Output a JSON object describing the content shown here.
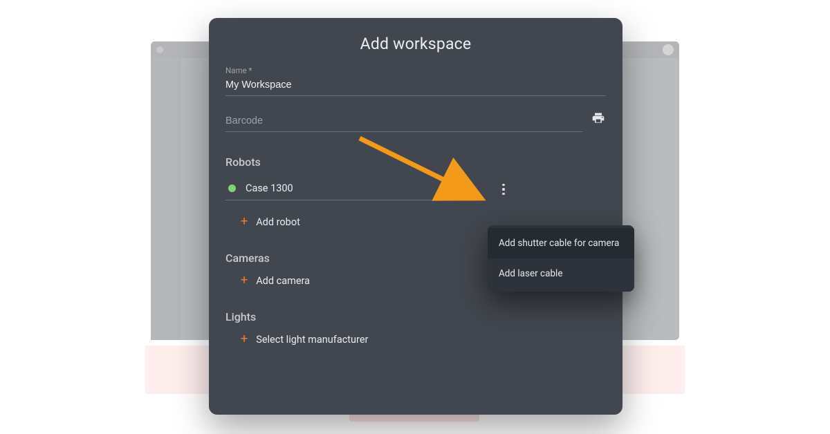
{
  "dialog": {
    "title": "Add workspace",
    "name": {
      "label": "Name *",
      "value": "My Workspace"
    },
    "barcode": {
      "placeholder": "Barcode",
      "value": ""
    },
    "sections": {
      "robots": {
        "heading": "Robots",
        "selected": {
          "name": "Case 1300",
          "status_color": "#7fd37a"
        },
        "add_label": "Add robot"
      },
      "cameras": {
        "heading": "Cameras",
        "add_label": "Add camera"
      },
      "lights": {
        "heading": "Lights",
        "add_label": "Select light manufacturer"
      }
    }
  },
  "context_menu": {
    "items": [
      "Add shutter cable for camera",
      "Add laser cable"
    ]
  },
  "icons": {
    "print": "print-icon",
    "kebab": "more-vert-icon",
    "chevron_down": "chevron-down-icon",
    "plus": "plus-icon"
  },
  "colors": {
    "accent": "#f2762e",
    "dialog_bg": "#42464e",
    "menu_bg": "#2e323a",
    "status_online": "#7fd37a"
  }
}
